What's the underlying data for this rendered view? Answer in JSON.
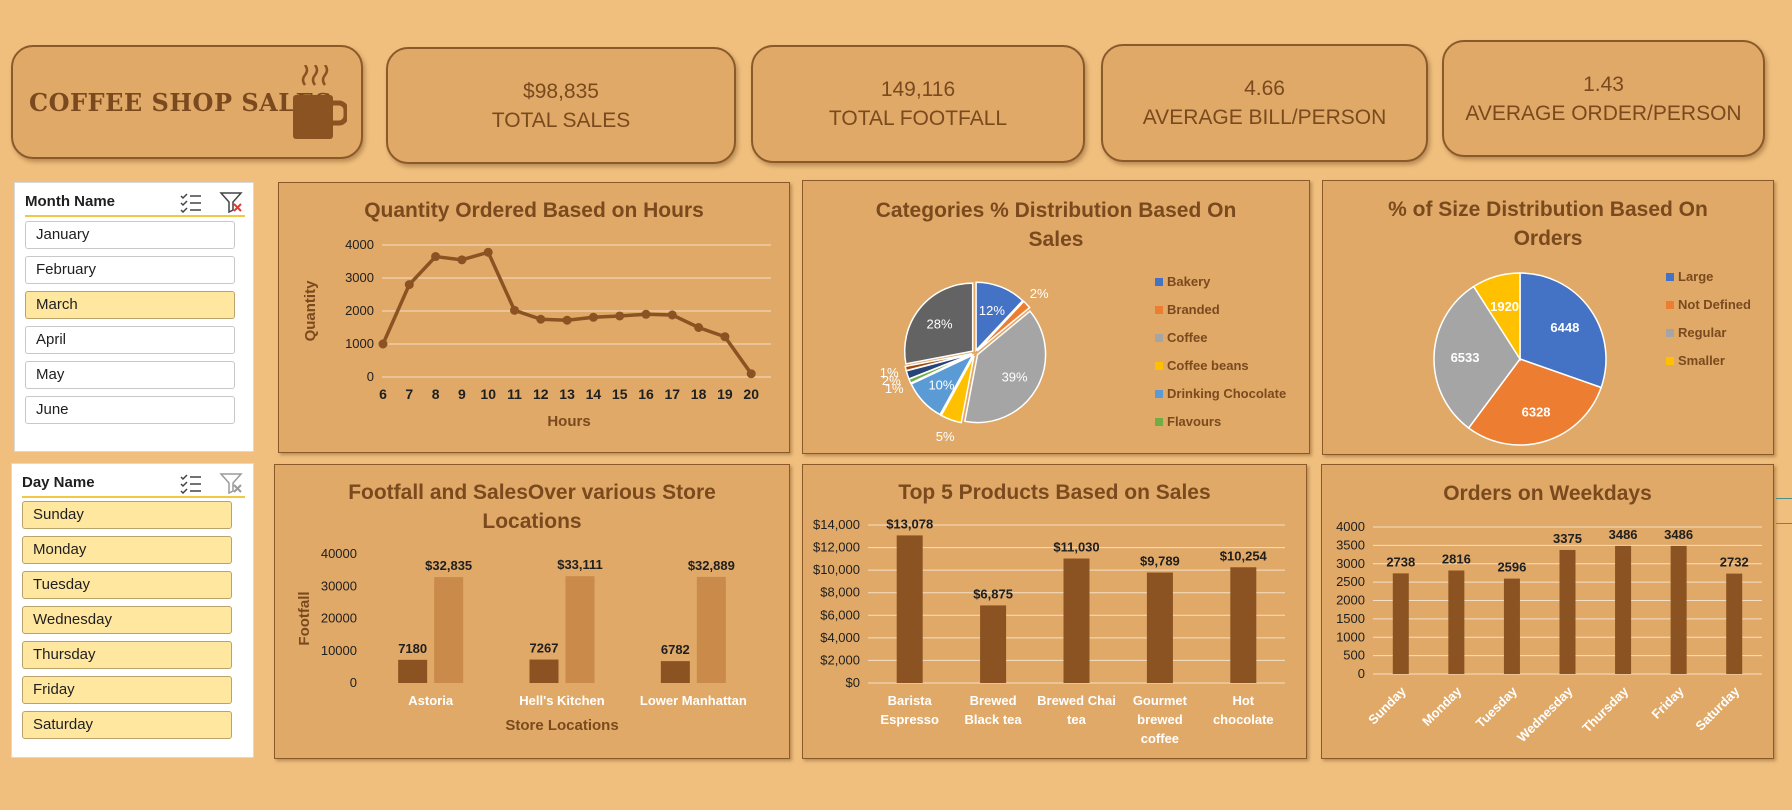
{
  "brand": {
    "title": "COFFEE SHOP SALES",
    "icon": "coffee-mug-icon"
  },
  "kpis": [
    {
      "value": "$98,835",
      "label": "TOTAL SALES"
    },
    {
      "value": "149,116",
      "label": "TOTAL FOOTFALL"
    },
    {
      "value": "4.66",
      "label": "AVERAGE BILL/PERSON"
    },
    {
      "value": "1.43",
      "label": "AVERAGE ORDER/PERSON"
    }
  ],
  "slicers": {
    "month": {
      "title": "Month Name",
      "items": [
        "January",
        "February",
        "March",
        "April",
        "May",
        "June"
      ],
      "selected": [
        "March"
      ]
    },
    "day": {
      "title": "Day Name",
      "items": [
        "Sunday",
        "Monday",
        "Tuesday",
        "Wednesday",
        "Thursday",
        "Friday",
        "Saturday"
      ],
      "selected": [
        "Sunday",
        "Monday",
        "Tuesday",
        "Wednesday",
        "Thursday",
        "Friday",
        "Saturday"
      ]
    }
  },
  "colors": {
    "bar_dark": "#8b5222",
    "bar_light": "#c98a4a",
    "line": "#8b5222",
    "title": "#7a4a1e",
    "panel": "#e0a968",
    "background": "#f0bf7d"
  },
  "chart_data": [
    {
      "id": "hours",
      "type": "line",
      "title": "Quantity Ordered Based on Hours",
      "xlabel": "Hours",
      "ylabel": "Quantity",
      "x": [
        "6",
        "7",
        "8",
        "9",
        "10",
        "11",
        "12",
        "13",
        "14",
        "15",
        "16",
        "17",
        "18",
        "19",
        "20"
      ],
      "values": [
        1000,
        2800,
        3650,
        3550,
        3780,
        2020,
        1750,
        1720,
        1810,
        1850,
        1900,
        1880,
        1500,
        1220,
        100
      ],
      "ylim": [
        0,
        4000
      ],
      "yticks": [
        "0",
        "1000",
        "2000",
        "3000",
        "4000"
      ],
      "grid": true
    },
    {
      "id": "categories",
      "type": "pie",
      "title": "Categories % Distribution Based On Sales",
      "legend": [
        "Bakery",
        "Branded",
        "Coffee",
        "Coffee beans",
        "Drinking Chocolate",
        "Flavours"
      ],
      "slices": [
        {
          "name": "Bakery",
          "value": 12,
          "label": "12%",
          "color": "#4472c4"
        },
        {
          "name": "Branded",
          "value": 2,
          "label": "2%",
          "color": "#ed7d31"
        },
        {
          "name": "Coffee",
          "value": 39,
          "label": "39%",
          "color": "#a5a5a5"
        },
        {
          "name": "Coffee beans",
          "value": 5,
          "label": "5%",
          "color": "#ffc000"
        },
        {
          "name": "Drinking Chocolate",
          "value": 10,
          "label": "10%",
          "color": "#5b9bd5"
        },
        {
          "name": "Flavours",
          "value": 1,
          "label": "1%",
          "color": "#70ad47"
        },
        {
          "name": "",
          "value": 2,
          "label": "2%",
          "color": "#264478"
        },
        {
          "name": "",
          "value": 1,
          "label": "1%",
          "color": "#9e480e"
        },
        {
          "name": "",
          "value": 28,
          "label": "28%",
          "color": "#636363"
        }
      ],
      "legend_placement": "right"
    },
    {
      "id": "sizes",
      "type": "pie",
      "title": "% of Size Distribution Based On Orders",
      "legend": [
        "Large",
        "Not Defined",
        "Regular",
        "Smaller"
      ],
      "slices": [
        {
          "name": "Large",
          "value": 6448,
          "label": "6448",
          "color": "#4472c4"
        },
        {
          "name": "Not Defined",
          "value": 6328,
          "label": "6328",
          "color": "#ed7d31"
        },
        {
          "name": "Regular",
          "value": 6533,
          "label": "6533",
          "color": "#a5a5a5"
        },
        {
          "name": "Smaller",
          "value": 1920,
          "label": "1920",
          "color": "#ffc000"
        }
      ],
      "legend_placement": "right"
    },
    {
      "id": "stores",
      "type": "bar",
      "title": "Footfall and SalesOver various Store Locations",
      "xlabel": "Store Locations",
      "ylabel": "Footfall",
      "categories": [
        "Astoria",
        "Hell's Kitchen",
        "Lower Manhattan"
      ],
      "series": [
        {
          "values": [
            7180,
            7267,
            6782
          ],
          "labels": [
            "7180",
            "7267",
            "6782"
          ]
        },
        {
          "values": [
            32835,
            33111,
            32889
          ],
          "labels": [
            "$32,835",
            "$33,111",
            "$32,889"
          ]
        }
      ],
      "ylim": [
        0,
        40000
      ],
      "yticks": [
        "0",
        "10000",
        "20000",
        "30000",
        "40000"
      ]
    },
    {
      "id": "products",
      "type": "bar",
      "title": "Top 5 Products Based on Sales",
      "categories": [
        [
          "Barista",
          "Espresso"
        ],
        [
          "Brewed",
          "Black tea"
        ],
        [
          "Brewed Chai",
          "tea"
        ],
        [
          "Gourmet",
          "brewed",
          "coffee"
        ],
        [
          "Hot",
          "chocolate"
        ]
      ],
      "values": [
        13078,
        6875,
        11030,
        9789,
        10254
      ],
      "labels": [
        "$13,078",
        "$6,875",
        "$11,030",
        "$9,789",
        "$10,254"
      ],
      "ylim": [
        0,
        14000
      ],
      "yticks": [
        "$0",
        "$2,000",
        "$4,000",
        "$6,000",
        "$8,000",
        "$10,000",
        "$12,000",
        "$14,000"
      ],
      "grid": true
    },
    {
      "id": "weekdays",
      "type": "bar",
      "title": "Orders on Weekdays",
      "categories": [
        "Sunday",
        "Monday",
        "Tuesday",
        "Wednesday",
        "Thursday",
        "Friday",
        "Saturday"
      ],
      "values": [
        2738,
        2816,
        2596,
        3375,
        3486,
        3486,
        2732
      ],
      "labels": [
        "2738",
        "2816",
        "2596",
        "3375",
        "3486",
        "3486",
        "2732"
      ],
      "ylim": [
        0,
        4000
      ],
      "yticks": [
        "0",
        "500",
        "1000",
        "1500",
        "2000",
        "2500",
        "3000",
        "3500",
        "4000"
      ],
      "grid": true
    }
  ]
}
